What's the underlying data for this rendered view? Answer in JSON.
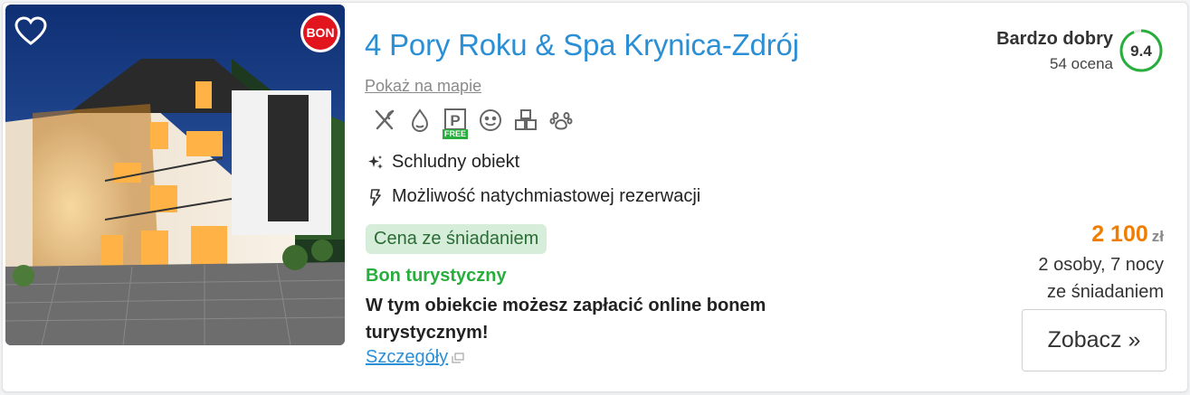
{
  "listing": {
    "title": "4 Pory Roku & Spa Krynica-Zdrój",
    "map_link": "Pokaż na mapie",
    "badge": "BON",
    "amenity_icons": [
      "restaurant-icon",
      "spa-icon",
      "parking-icon",
      "kids-icon",
      "playroom-icon",
      "pets-icon"
    ],
    "parking_badge": "FREE",
    "features": [
      "Schludny obiekt",
      "Możliwość natychmiastowej rezerwacji"
    ],
    "meal_pill": "Cena ze śniadaniem",
    "voucher": {
      "heading": "Bon turystyczny",
      "text": "W tym obiekcie możesz zapłacić online bonem turystycznym!",
      "details_link": "Szczegóły"
    },
    "rating": {
      "label": "Bardzo dobry",
      "count": "54 ocena",
      "score": "9.4",
      "score_fraction": 0.94
    },
    "price": {
      "amount": "2 100",
      "currency": "zł",
      "guests_nights": "2 osoby, 7 nocy",
      "board": "ze śniadaniem"
    },
    "cta": "Zobacz »"
  },
  "colors": {
    "title": "#2b8fd6",
    "price": "#f07d00",
    "green": "#27ae3c",
    "bon_red": "#e2141e"
  }
}
